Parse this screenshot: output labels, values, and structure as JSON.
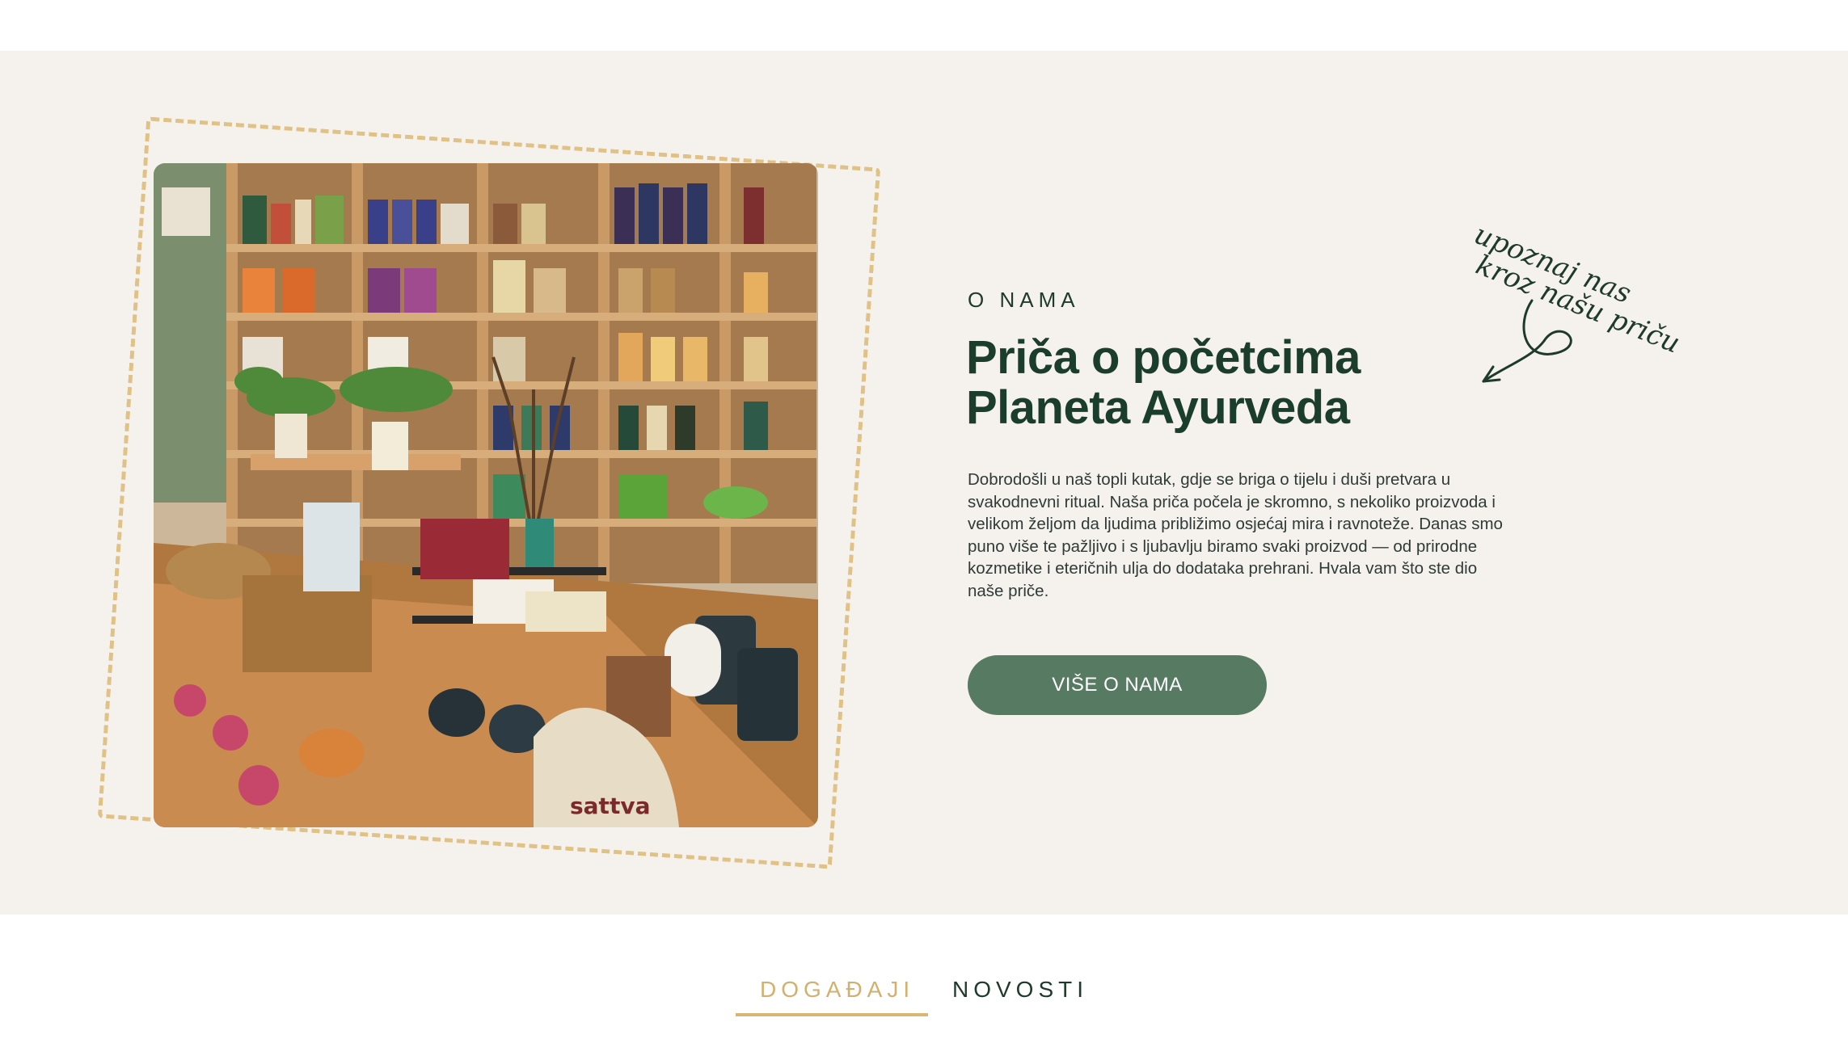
{
  "about": {
    "label": "O NAMA",
    "title_line1": "Priča o početcima",
    "title_line2": "Planeta Ayurveda",
    "body": "Dobrodošli u naš topli kutak, gdje se briga o tijelu i duši pretvara u svakodnevni ritual. Naša priča počela je skromno, s nekoliko proizvoda i velikom željom da ljudima približimo osjećaj mira i ravnoteže. Danas smo puno više te pažljivo i s ljubavlju biramo svaki proizvod — od prirodne kozmetike i eteričnih ulja do dodataka prehrani. Hvala vam što ste dio naše priče.",
    "button_label": "VIŠE O NAMA",
    "handnote_line1": "upoznaj nas",
    "handnote_line2": "kroz našu priču",
    "photo_bag_text": "sattva"
  },
  "tabs": [
    {
      "label": "DOGAĐAJI",
      "active": true
    },
    {
      "label": "NOVOSTI",
      "active": false
    }
  ],
  "colors": {
    "section_bg": "#f5f2ed",
    "heading_green": "#1b3d2c",
    "button_green": "#577a62",
    "accent_gold": "#d8b676"
  }
}
